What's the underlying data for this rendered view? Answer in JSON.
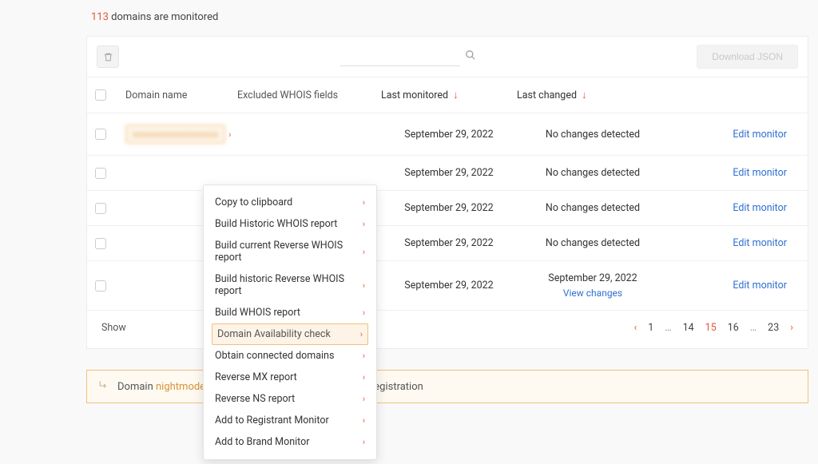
{
  "header": {
    "count": "113",
    "rest": " domains are monitored"
  },
  "toolbar": {
    "search_placeholder": "",
    "download_label": "Download JSON"
  },
  "columns": {
    "domain": "Domain name",
    "excluded": "Excluded WHOIS fields",
    "last_monitored": "Last monitored",
    "last_changed": "Last changed"
  },
  "sort_arrow": "↓",
  "rows": [
    {
      "domain_blur": "xxxxxxxxxxxxxxxxxx",
      "monitored": "September 29, 2022",
      "changed": "No changes detected",
      "view_changes": "",
      "edit": "Edit monitor"
    },
    {
      "domain_blur": "",
      "monitored": "September 29, 2022",
      "changed": "No changes detected",
      "view_changes": "",
      "edit": "Edit monitor"
    },
    {
      "domain_blur": "",
      "monitored": "September 29, 2022",
      "changed": "No changes detected",
      "view_changes": "",
      "edit": "Edit monitor"
    },
    {
      "domain_blur": "",
      "monitored": "September 29, 2022",
      "changed": "No changes detected",
      "view_changes": "",
      "edit": "Edit monitor"
    },
    {
      "domain_blur": "",
      "monitored": "September 29, 2022",
      "changed": "September 29, 2022",
      "view_changes": "View changes",
      "edit": "Edit monitor"
    }
  ],
  "footer": {
    "show_label": "Show"
  },
  "pagination": {
    "pages": [
      "1",
      "…",
      "14",
      "15",
      "16",
      "…",
      "23"
    ],
    "active_index": 3
  },
  "popover": {
    "items": [
      "Copy to clipboard",
      "Build Historic WHOIS report",
      "Build current Reverse WHOIS report",
      "Build historic Reverse WHOIS report",
      "Build WHOIS report",
      "Domain Availability check",
      "Obtain connected domains",
      "Reverse MX report",
      "Reverse NS report",
      "Add to Registrant Monitor",
      "Add to Brand Monitor"
    ],
    "highlighted_index": 5
  },
  "toast": {
    "prefix": "Domain ",
    "domain": "nightmodeforyoutubext.com",
    "suffix": " is unavailable for registration"
  }
}
